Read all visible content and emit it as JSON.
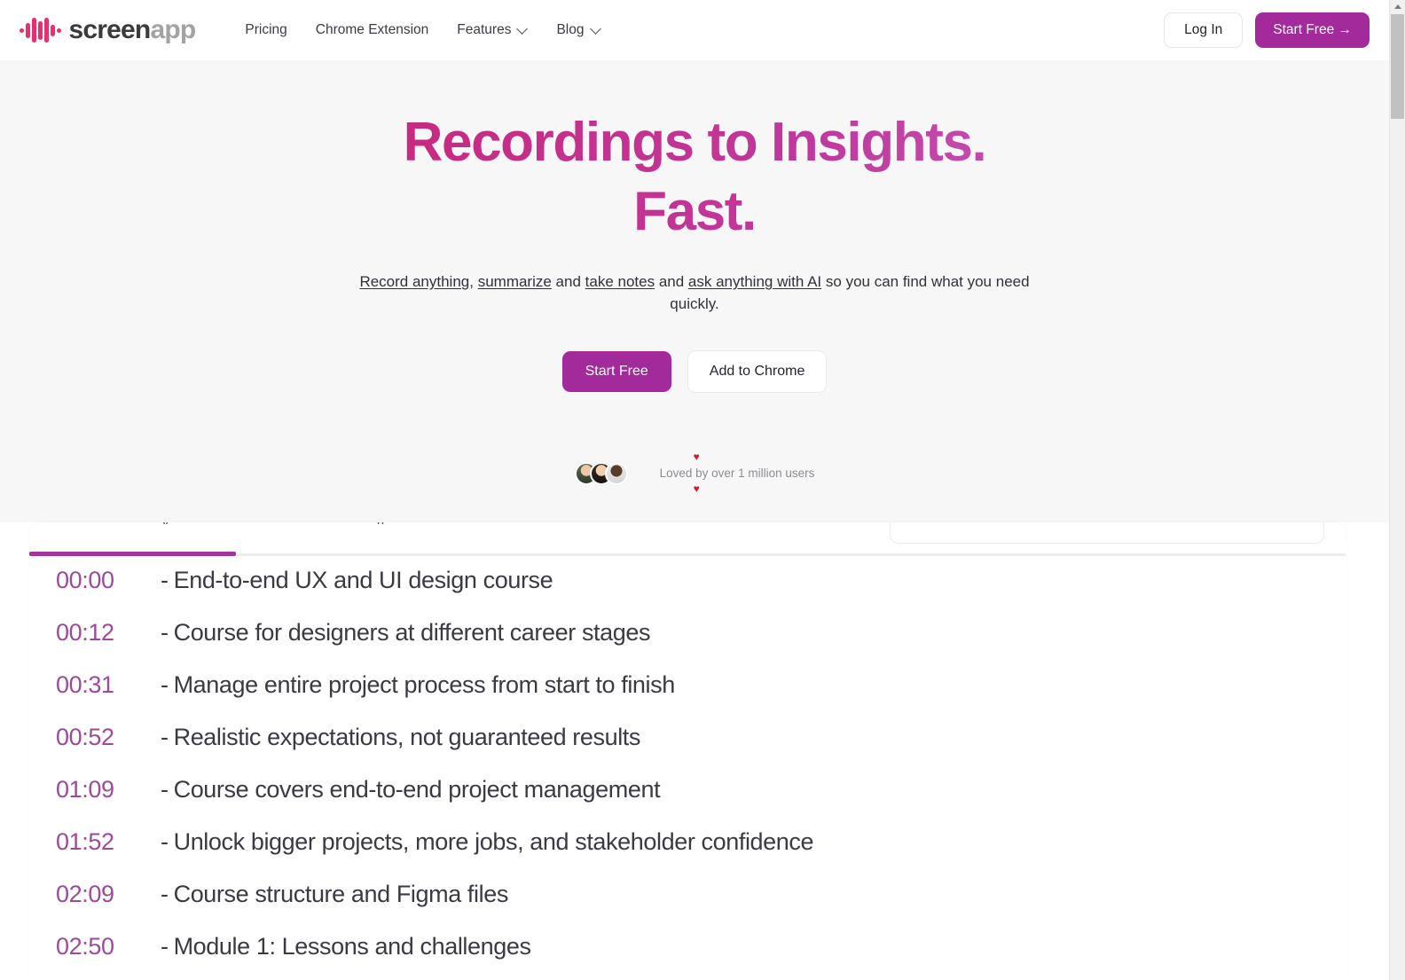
{
  "brand": {
    "logo_screen": "screen",
    "logo_app": "app",
    "accent_magenta": "#a32a9b",
    "accent_pink": "#e6306f",
    "tab_underline": "#a3349e",
    "timestamp_color": "#9d4a9a"
  },
  "navbar": {
    "links": [
      {
        "label": "Pricing",
        "has_chevron": false
      },
      {
        "label": "Chrome Extension",
        "has_chevron": false
      },
      {
        "label": "Features",
        "has_chevron": true
      },
      {
        "label": "Blog",
        "has_chevron": true
      }
    ],
    "login_label": "Log In",
    "start_free_label": "Start Free →"
  },
  "hero": {
    "title_line1": "Recordings to Insights.",
    "title_line2": "Fast.",
    "subtitle": {
      "link1": "Record anything",
      "sep1": ", ",
      "link2": "summarize",
      "sep2": " and ",
      "link3": "take notes",
      "sep3": " and ",
      "link4": "ask anything with AI",
      "tail": " so you can find what you need quickly."
    },
    "cta_primary": "Start Free",
    "cta_secondary": "Add to Chrome",
    "social_proof_text": "Loved by over 1 million users",
    "heart_glyph": "♥"
  },
  "card": {
    "tab_labels_clipped": [
      "y",
      "p"
    ],
    "transcript": [
      {
        "time": "00:00",
        "text": "End-to-end UX and UI design course"
      },
      {
        "time": "00:12",
        "text": "Course for designers at different career stages"
      },
      {
        "time": "00:31",
        "text": "Manage entire project process from start to finish"
      },
      {
        "time": "00:52",
        "text": "Realistic expectations, not guaranteed results"
      },
      {
        "time": "01:09",
        "text": "Course covers end-to-end project management"
      },
      {
        "time": "01:52",
        "text": "Unlock bigger projects, more jobs, and stakeholder confidence"
      },
      {
        "time": "02:09",
        "text": "Course structure and Figma files"
      },
      {
        "time": "02:50",
        "text": "Module 1: Lessons and challenges"
      }
    ],
    "dash": "-"
  }
}
